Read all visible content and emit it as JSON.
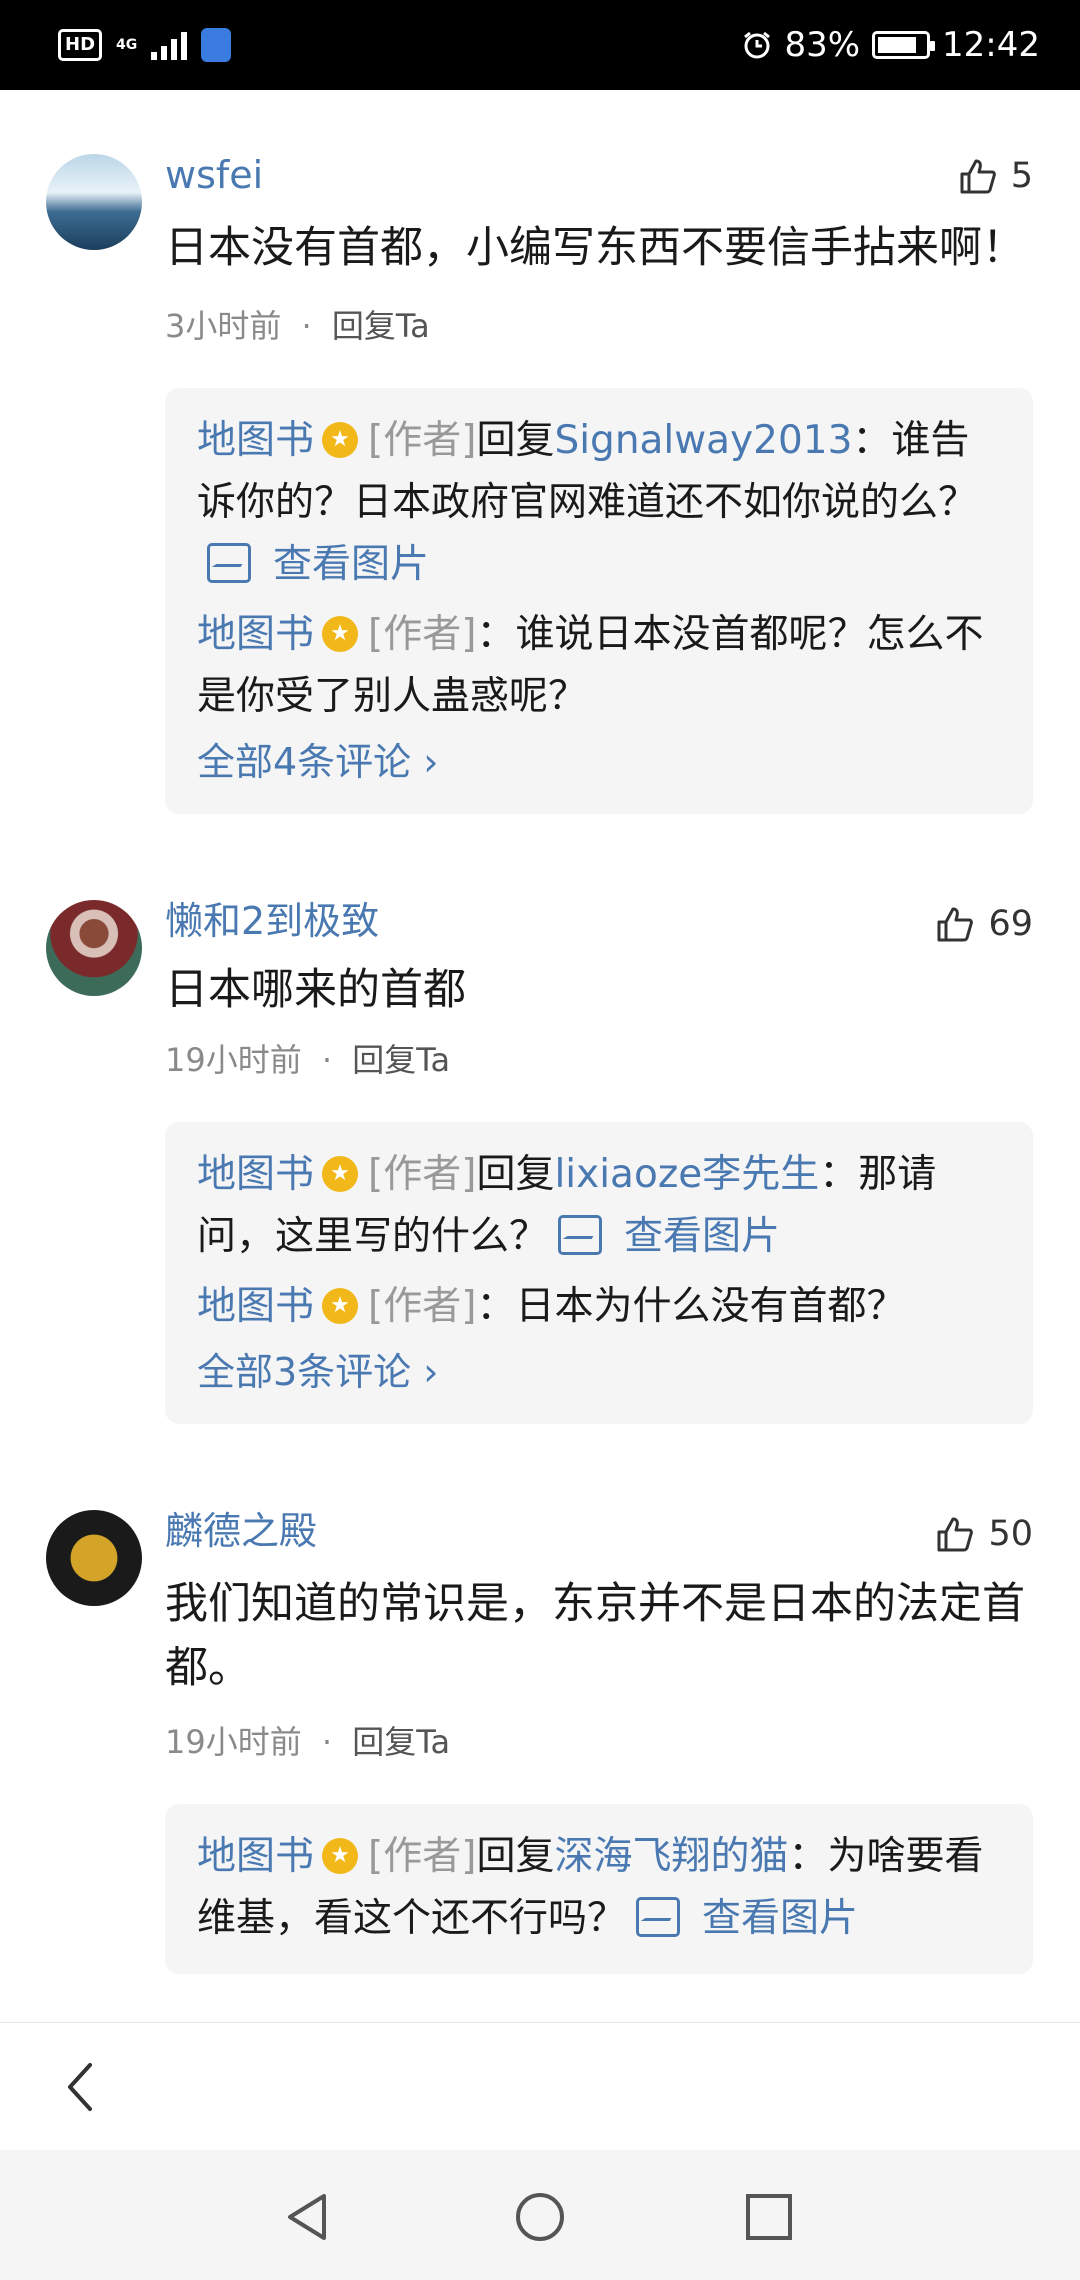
{
  "status_bar": {
    "left_icons": [
      "hd-icon",
      "4g-signal-icon",
      "vpn-shield-icon"
    ],
    "network_label": "HD",
    "network_type": "4G",
    "battery": "83%",
    "time": "12:42"
  },
  "comments": [
    {
      "author": "wsfei",
      "likes": "5",
      "text": "日本没有首都，小编写东西不要信手拈来啊！",
      "time": "3小时前",
      "reply_label": "回复Ta",
      "replies": [
        {
          "name": "地图书",
          "tag": "[作者]",
          "reply_word": "回复",
          "target": "Signalway2013",
          "text": "：谁告诉你的？日本政府官网难道还不如你说的么？",
          "image_link": "查看图片"
        },
        {
          "name": "地图书",
          "tag": "[作者]",
          "text": "：谁说日本没首都呢？怎么不是你受了别人蛊惑呢？"
        }
      ],
      "all_link": "全部4条评论"
    },
    {
      "author": "懒和2到极致",
      "likes": "69",
      "text": "日本哪来的首都",
      "time": "19小时前",
      "reply_label": "回复Ta",
      "replies": [
        {
          "name": "地图书",
          "tag": "[作者]",
          "reply_word": "回复",
          "target": "lixiaoze李先生",
          "text": "：那请问，这里写的什么？",
          "image_link": "查看图片"
        },
        {
          "name": "地图书",
          "tag": "[作者]",
          "text": "：日本为什么没有首都？"
        }
      ],
      "all_link": "全部3条评论"
    },
    {
      "author": "麟德之殿",
      "likes": "50",
      "text": "我们知道的常识是，东京并不是日本的法定首都。",
      "time": "19小时前",
      "reply_label": "回复Ta",
      "replies": [
        {
          "name": "地图书",
          "tag": "[作者]",
          "reply_word": "回复",
          "target": "深海飞翔的猫",
          "text": "：为啥要看维基，看这个还不行吗？",
          "image_link": "查看图片"
        }
      ]
    }
  ],
  "separator": "·",
  "colors": {
    "link": "#4a79b1",
    "badge": "#f2b81a",
    "reply_bg": "#f5f5f6"
  }
}
